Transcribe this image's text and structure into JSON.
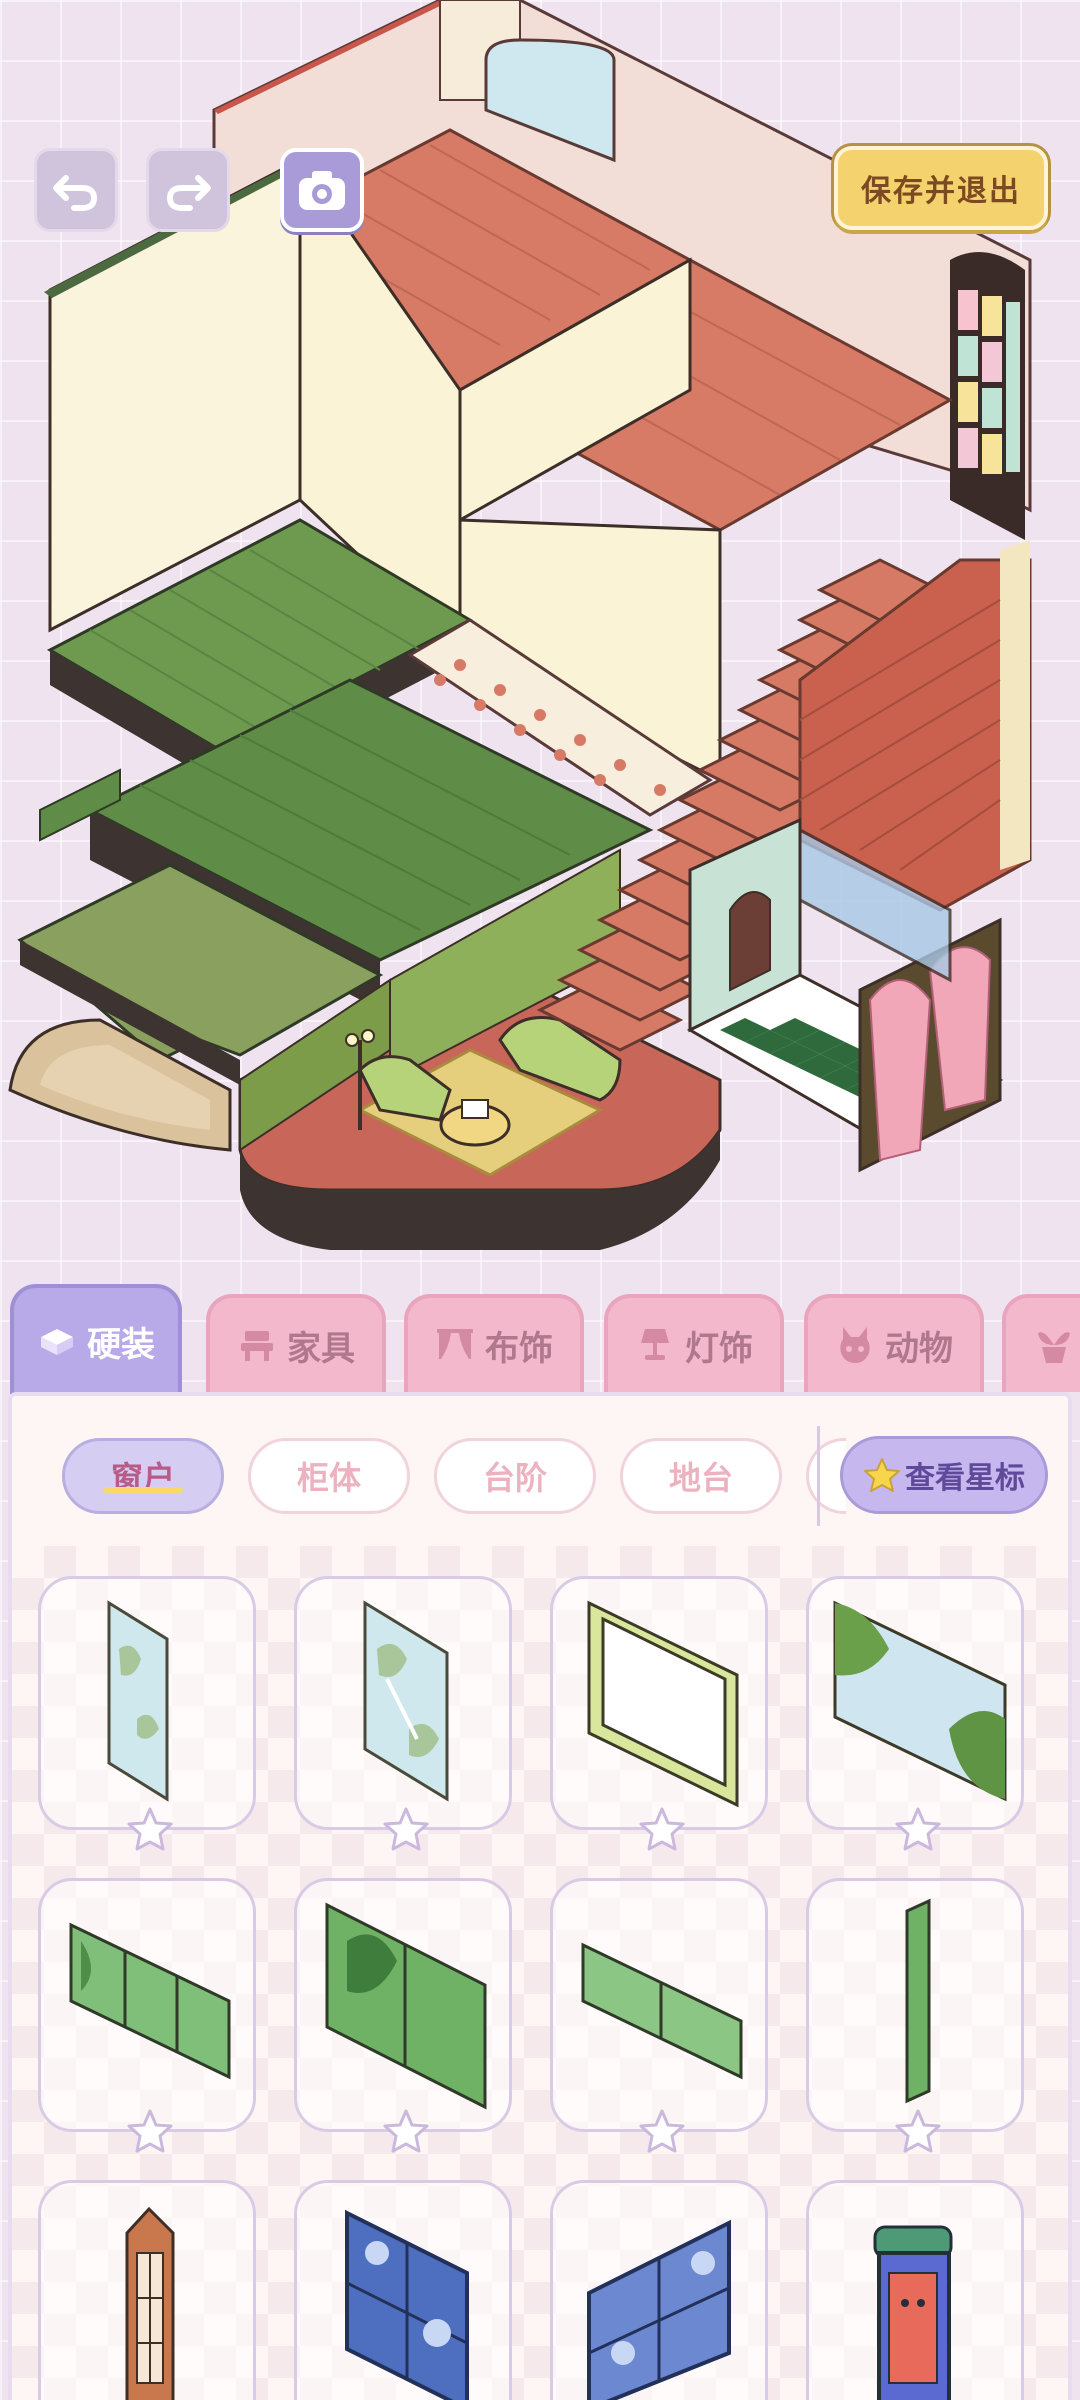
{
  "toolbar": {
    "undo_icon": "undo-icon",
    "redo_icon": "redo-icon",
    "camera_icon": "camera-icon",
    "save_label": "保存并退出"
  },
  "category_tabs": [
    {
      "label": "硬装",
      "icon": "hardware-icon",
      "active": true
    },
    {
      "label": "家具",
      "icon": "furniture-icon",
      "active": false
    },
    {
      "label": "布饰",
      "icon": "curtain-icon",
      "active": false
    },
    {
      "label": "灯饰",
      "icon": "lamp-icon",
      "active": false
    },
    {
      "label": "动物",
      "icon": "animal-icon",
      "active": false
    },
    {
      "label": "",
      "icon": "plant-icon",
      "active": false
    }
  ],
  "sub_tabs": [
    {
      "label": "窗户",
      "active": true
    },
    {
      "label": "柜体",
      "active": false
    },
    {
      "label": "台阶",
      "active": false
    },
    {
      "label": "地台",
      "active": false
    }
  ],
  "star_view_label": "查看星标",
  "items": [
    {
      "name": "narrow-sky-window"
    },
    {
      "name": "narrow-sky-window-2"
    },
    {
      "name": "green-frame-window"
    },
    {
      "name": "forest-wide-window"
    },
    {
      "name": "forest-panorama-window"
    },
    {
      "name": "forest-square-window"
    },
    {
      "name": "forest-long-window"
    },
    {
      "name": "forest-slit-window"
    },
    {
      "name": "arched-wood-window"
    },
    {
      "name": "blue-pane-window"
    },
    {
      "name": "blue-wide-pane-window"
    },
    {
      "name": "shop-sign-window"
    }
  ],
  "colors": {
    "accent": "#b8a9e8",
    "save_button": "#f4d26e",
    "tab_inactive": "#f3b8cc",
    "panel": "#fdf6f4"
  }
}
